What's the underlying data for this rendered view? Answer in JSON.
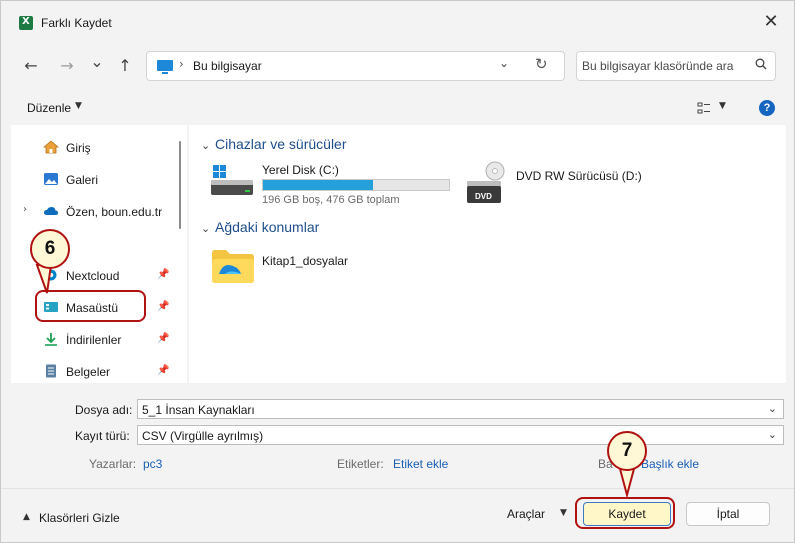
{
  "window": {
    "title": "Farklı Kaydet",
    "close_glyph": "✕"
  },
  "nav": {
    "back": "←",
    "forward": "→",
    "recent": "⌄",
    "up": "↑",
    "address_sep": "›",
    "address": "Bu bilgisayar",
    "search_placeholder": "Bu bilgisayar klasöründe ara"
  },
  "toolbar": {
    "organize": "Düzenle",
    "help": "?"
  },
  "sidebar": {
    "items": [
      {
        "label": "Giriş",
        "icon": "home-icon"
      },
      {
        "label": "Galeri",
        "icon": "gallery-icon"
      },
      {
        "label": "Özen, boun.edu.tr",
        "icon": "onedrive-icon",
        "expandable": true
      },
      {
        "label": "Nextcloud",
        "icon": "nextcloud-icon",
        "pinned": true
      },
      {
        "label": "Masaüstü",
        "icon": "desktop-icon",
        "pinned": true
      },
      {
        "label": "İndirilenler",
        "icon": "download-icon",
        "pinned": true
      },
      {
        "label": "Belgeler",
        "icon": "documents-icon",
        "pinned": true
      }
    ]
  },
  "main": {
    "devices_header": "Cihazlar ve sürücüler",
    "network_header": "Ağdaki konumlar",
    "drives": [
      {
        "name": "Yerel Disk (C:)",
        "detail": "196 GB boş, 476 GB toplam",
        "used_fraction": 0.59
      },
      {
        "name": "DVD RW Sürücüsü (D:)",
        "badge": "DVD"
      }
    ],
    "network_items": [
      {
        "name": "Kitap1_dosyalar"
      }
    ]
  },
  "form": {
    "filename_label": "Dosya adı:",
    "filename_value": "5_1 İnsan Kaynakları",
    "filetype_label": "Kayıt türü:",
    "filetype_value": "CSV (Virgülle ayrılmış)",
    "authors_label": "Yazarlar:",
    "authors_value": "pc3",
    "tags_label": "Etiketler:",
    "tags_value": "Etiket ekle",
    "title_label": "Ba",
    "title_value": "Başlık ekle"
  },
  "footer": {
    "hide_folders": "Klasörleri Gizle",
    "tools": "Araçlar",
    "save": "Kaydet",
    "cancel": "İptal"
  },
  "annotations": {
    "step_6": "6",
    "step_7": "7"
  },
  "colors": {
    "accent": "#1565c0",
    "highlight": "#b01212",
    "progress": "#26a0da"
  }
}
